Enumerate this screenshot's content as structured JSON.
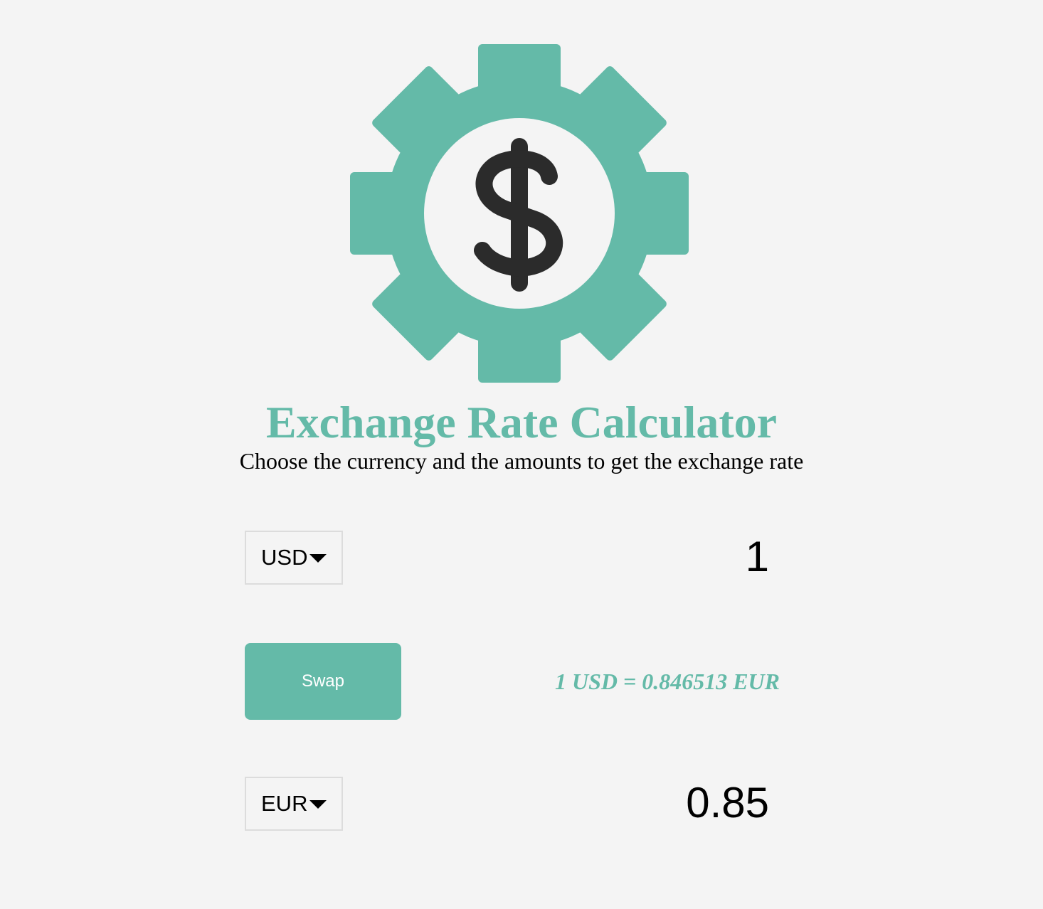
{
  "header": {
    "title": "Exchange Rate Calculator",
    "subtitle": "Choose the currency and the amounts to get the exchange rate"
  },
  "from": {
    "currency": "USD",
    "amount": "1"
  },
  "to": {
    "currency": "EUR",
    "amount": "0.85"
  },
  "swap": {
    "label": "Swap"
  },
  "rate": {
    "text": "1 USD = 0.846513 EUR"
  },
  "colors": {
    "accent": "#64baa8",
    "background": "#f4f4f4",
    "icon_dark": "#2b2b2b",
    "select_border": "#dcdcdc"
  },
  "icons": {
    "logo": "dollar-gear-icon",
    "dropdown": "caret-down-icon"
  }
}
